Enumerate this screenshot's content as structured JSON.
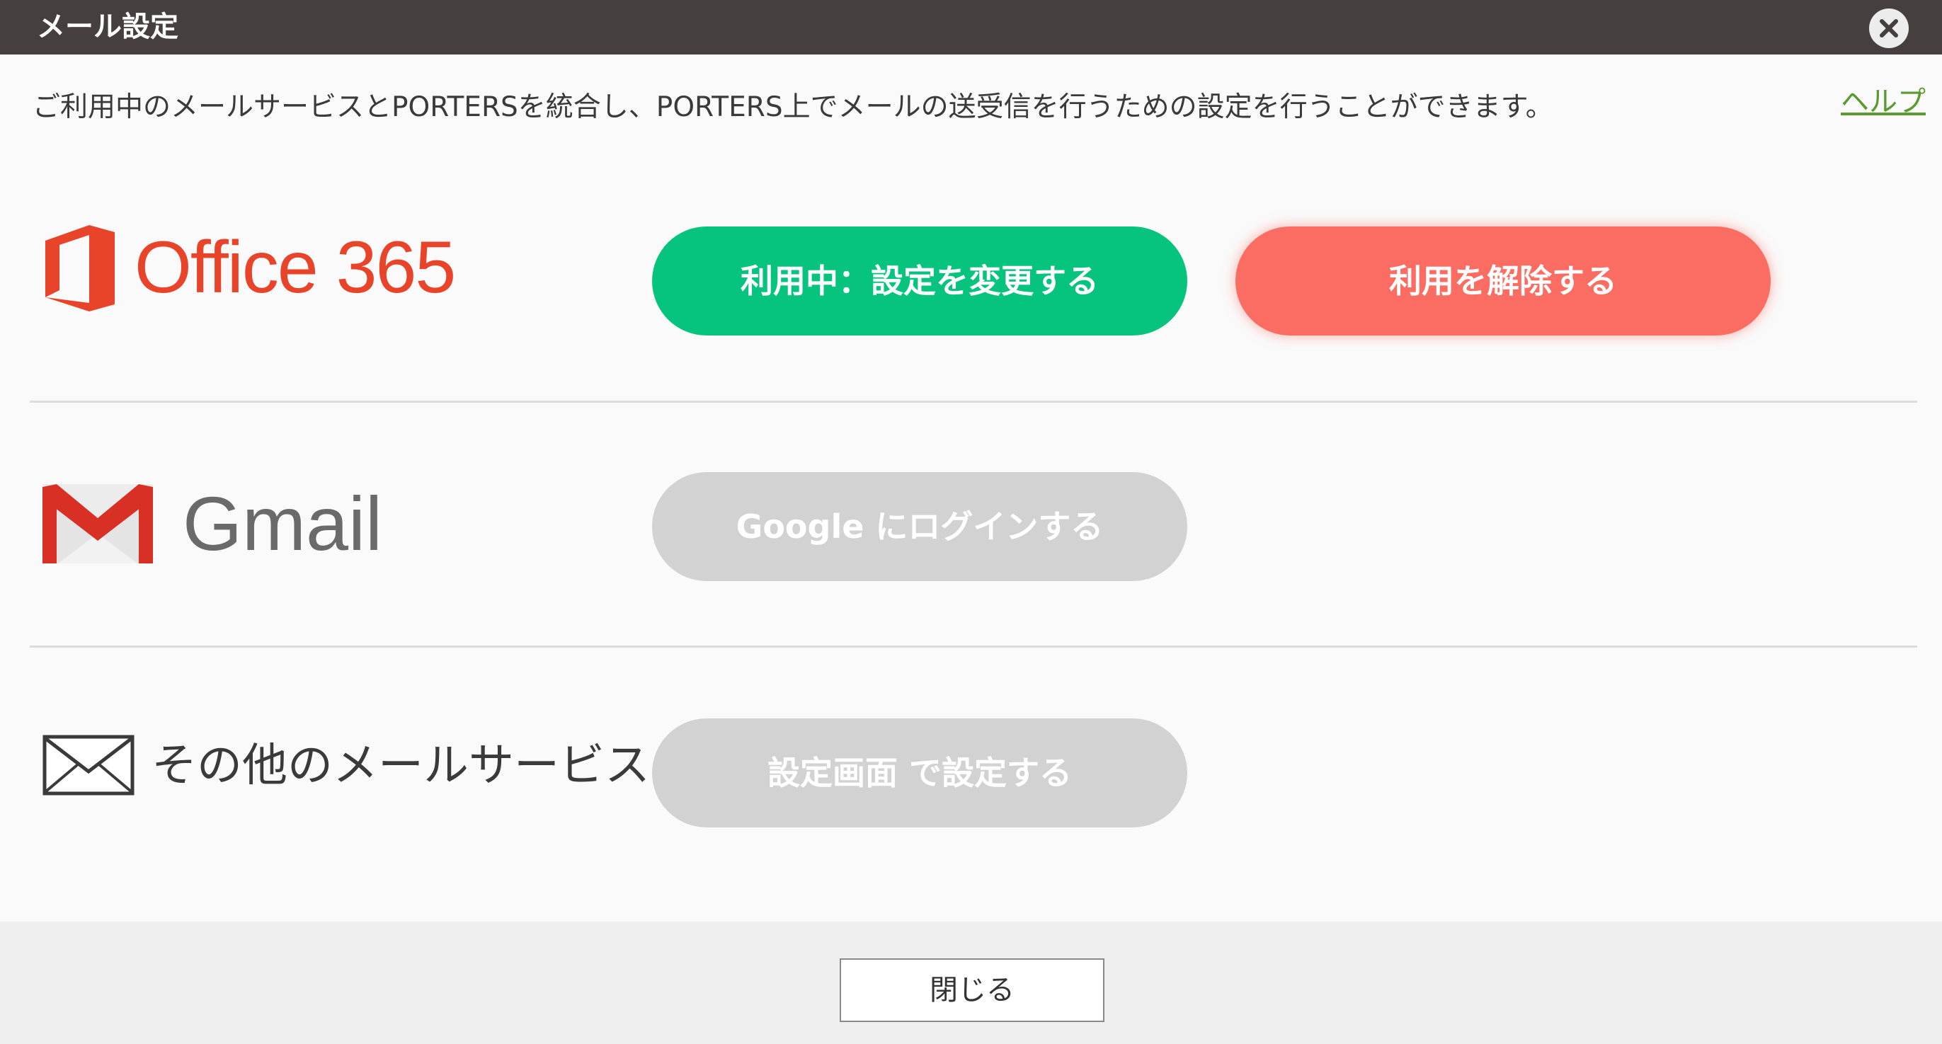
{
  "window": {
    "title": "メール設定",
    "close_icon": "close-icon"
  },
  "description": "ご利用中のメールサービスとPORTERSを統合し、PORTERS上でメールの送受信を行うための設定を行うことができます。",
  "help_link": "ヘルプ",
  "services": [
    {
      "name": "Office 365",
      "logo_icon": "office365-logo-icon",
      "primary_button": "利用中：設定を変更する",
      "secondary_button": "利用を解除する",
      "colors": {
        "primary": "#06c37e",
        "secondary": "#fb6d62",
        "logo": "#e8442a"
      }
    },
    {
      "name": "Gmail",
      "logo_icon": "gmail-logo-icon",
      "primary_button": "Google にログインする",
      "colors": {
        "primary": "#d2d2d2"
      }
    },
    {
      "name": "その他のメールサービス",
      "logo_icon": "envelope-icon",
      "primary_button": "設定画面 で設定する",
      "colors": {
        "primary": "#d2d2d2"
      }
    }
  ],
  "footer": {
    "close_button": "閉じる"
  },
  "colors": {
    "titlebar": "#463f3f",
    "help_link": "#5a9a2e",
    "footer": "#efefef"
  }
}
